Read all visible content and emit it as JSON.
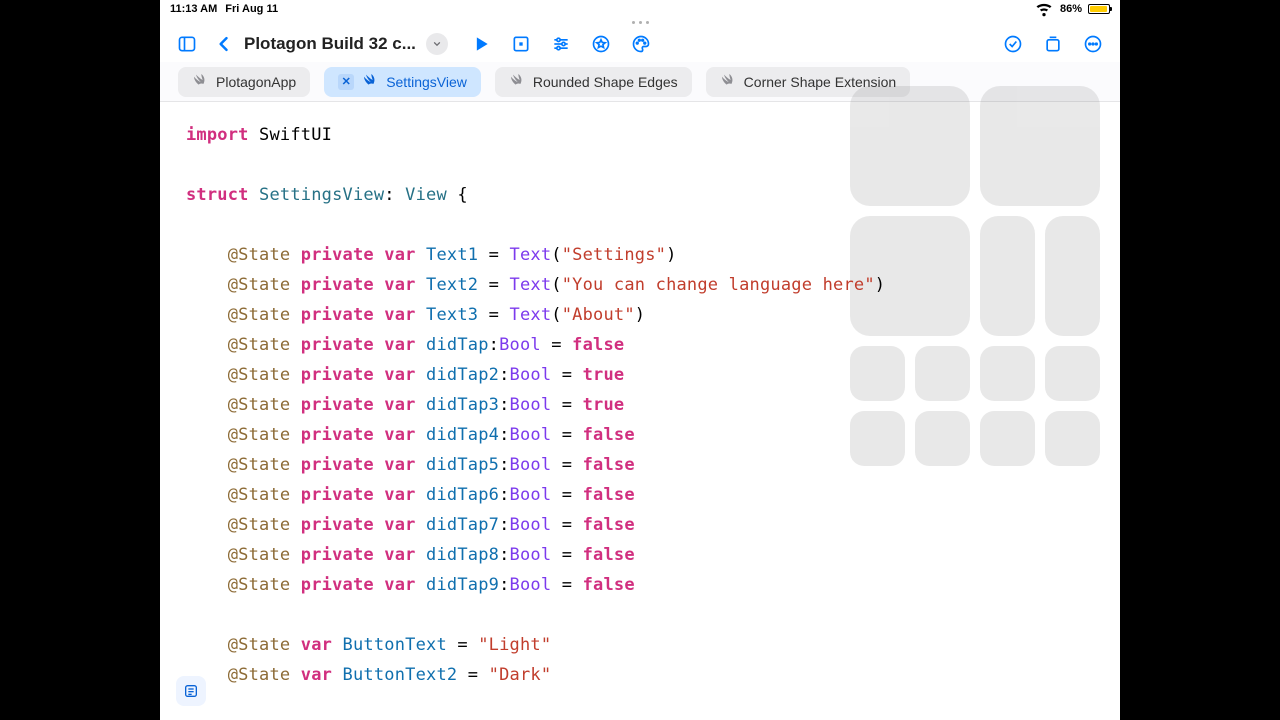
{
  "status": {
    "time": "11:13 AM",
    "date": "Fri Aug 11",
    "battery_pct": "86%"
  },
  "toolbar": {
    "project_title": "Plotagon Build 32 c..."
  },
  "tabs": [
    {
      "label": "PlotagonApp",
      "active": false
    },
    {
      "label": "SettingsView",
      "active": true
    },
    {
      "label": "Rounded Shape Edges",
      "active": false
    },
    {
      "label": "Corner Shape Extension",
      "active": false
    }
  ],
  "code": {
    "l1_import": "import",
    "l1_mod": "SwiftUI",
    "l3_struct": "struct",
    "l3_name": "SettingsView",
    "l3_proto": "View",
    "attr_state": "@State",
    "kw_private": "private",
    "kw_var": "var",
    "type_bool": "Bool",
    "kw_true": "true",
    "kw_false": "false",
    "fn_text": "Text",
    "v_text1": "Text1",
    "v_text2": "Text2",
    "v_text3": "Text3",
    "s_settings": "\"Settings\"",
    "s_lang": "\"You can change language here\"",
    "s_about": "\"About\"",
    "v_d1": "didTap",
    "v_d2": "didTap2",
    "v_d3": "didTap3",
    "v_d4": "didTap4",
    "v_d5": "didTap5",
    "v_d6": "didTap6",
    "v_d7": "didTap7",
    "v_d8": "didTap8",
    "v_d9": "didTap9",
    "v_bt": "ButtonText",
    "v_bt2": "ButtonText2",
    "s_light": "\"Light\"",
    "s_dark": "\"Dark\""
  }
}
